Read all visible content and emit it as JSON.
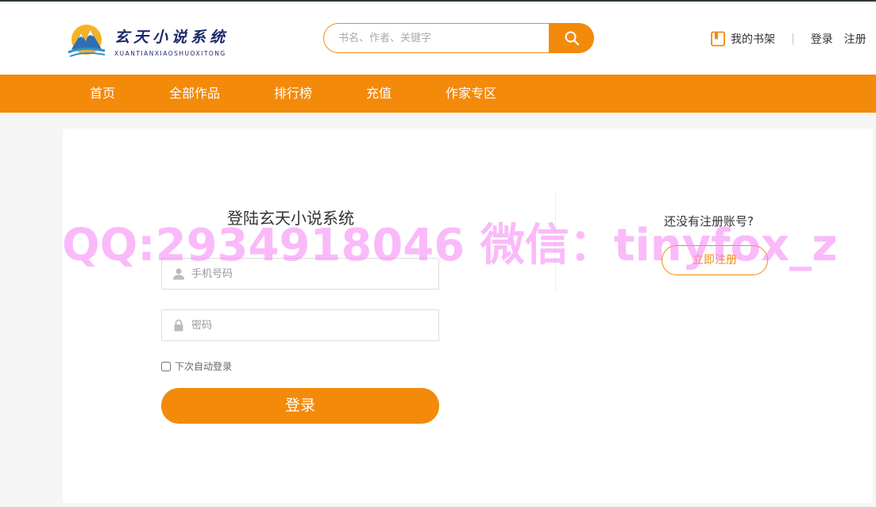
{
  "brand": {
    "name_cn": "玄天小说系统",
    "name_en": "XUANTIANXIAOSHUOXITONG",
    "accent": "#f38a0a",
    "logo_blue": "#1b2a6b"
  },
  "search": {
    "placeholder": "书名、作者、关键字",
    "icon": "search-icon"
  },
  "top_links": {
    "bookshelf_label": "我的书架",
    "bookshelf_icon": "book-icon",
    "separator": "|",
    "login_label": "登录",
    "register_label": "注册"
  },
  "nav": {
    "items": [
      {
        "label": "首页"
      },
      {
        "label": "全部作品"
      },
      {
        "label": "排行榜"
      },
      {
        "label": "充值"
      },
      {
        "label": "作家专区"
      }
    ]
  },
  "login": {
    "title": "登陆玄天小说系统",
    "phone_placeholder": "手机号码",
    "phone_icon": "user-icon",
    "password_placeholder": "密码",
    "password_icon": "lock-icon",
    "remember_label": "下次自动登录",
    "submit_label": "登录"
  },
  "register": {
    "prompt": "还没有注册账号?",
    "button_label": "立即注册"
  },
  "watermark": "QQ:2934918046 微信：tinyfox_z"
}
